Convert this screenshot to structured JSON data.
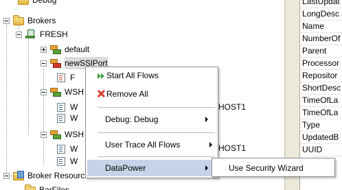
{
  "tree": {
    "debug_label": "Debug",
    "brokers_label": "Brokers",
    "fresh_label": "FRESH",
    "default_label": "default",
    "newsslport_label": "newSSlPort",
    "flow_f_label": "F",
    "wsh1_label": "WSH",
    "w1a_label": "W",
    "w1b_label": "W",
    "host1_label": "HOST1",
    "wsh2_label": "WSH",
    "w2a_label": "W",
    "w2b_label": "W",
    "host2_label": "HOST1",
    "broker_resources_label": "Broker Resources",
    "barfiles_label": "BarFiles"
  },
  "properties": {
    "names": [
      "LastUpdat",
      "LongDesc",
      "Name",
      "NumberOf",
      "Parent",
      "Processor",
      "Repositor",
      "ShortDesc",
      "TimeOfLa",
      "TimeOfLa",
      "Type",
      "UpdatedB",
      "UUID"
    ]
  },
  "context_menu": {
    "start_all_flows": "Start All Flows",
    "remove_all": "Remove All",
    "debug": "Debug: Debug",
    "user_trace": "User Trace All Flows",
    "datapower": "DataPower"
  },
  "submenu": {
    "use_security_wizard": "Use Security Wizard"
  },
  "colors": {
    "menu_highlight": "#c7d3e8",
    "selection": "#dcdcdc"
  }
}
